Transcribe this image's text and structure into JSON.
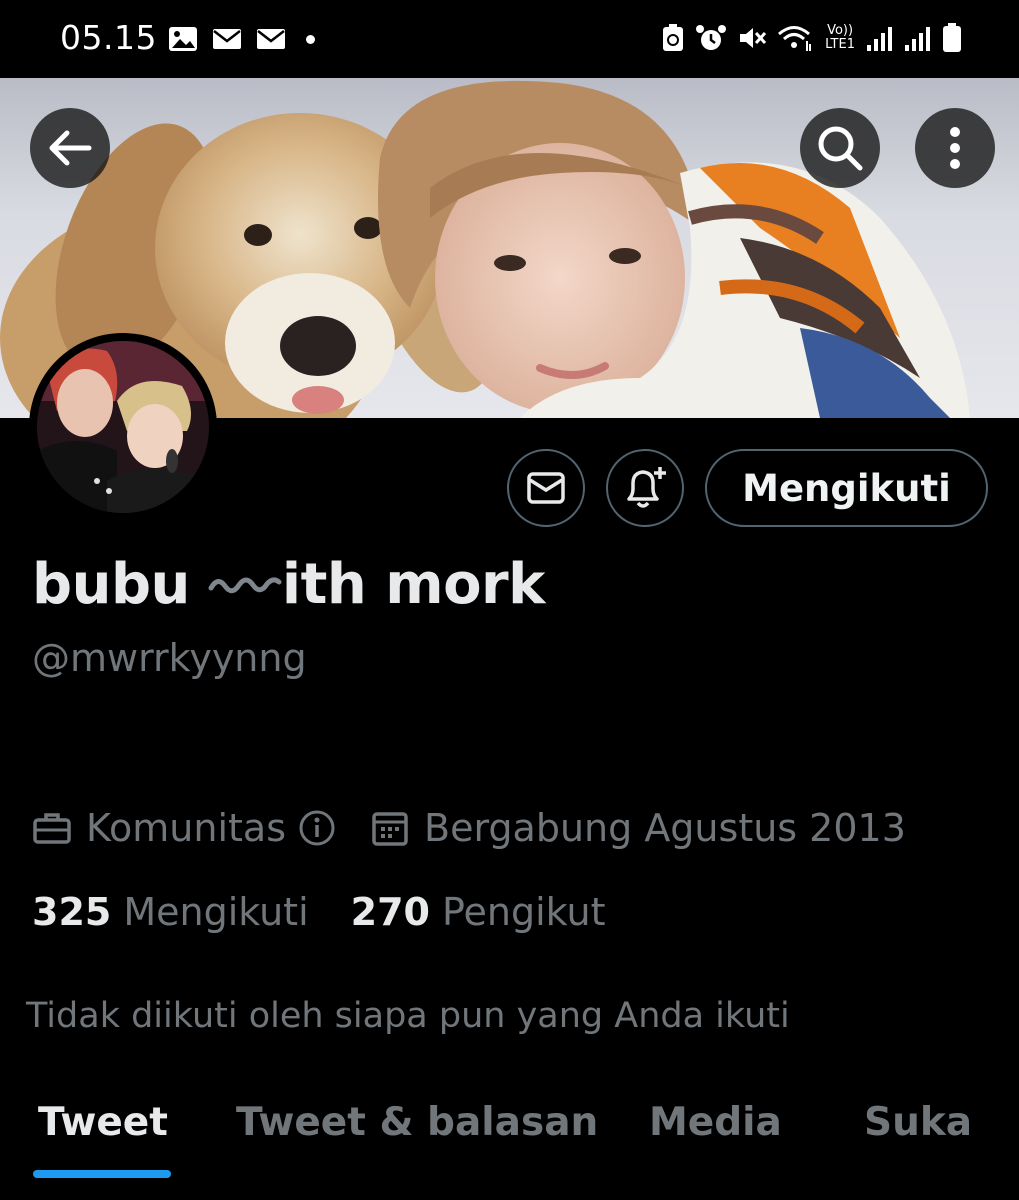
{
  "status_bar": {
    "time": "05.15",
    "lte_line1": "Vo))",
    "lte_line2": "LTE1"
  },
  "profile": {
    "display_name_prefix": "bubu",
    "display_name_suffix": "ith mork",
    "handle": "@mwrrkyynng",
    "category": "Komunitas",
    "joined": "Bergabung Agustus 2013",
    "following_count": "325",
    "following_label": "Mengikuti",
    "followers_count": "270",
    "followers_label": "Pengikut",
    "not_followed_text": "Tidak diikuti oleh siapa pun yang Anda ikuti"
  },
  "actions": {
    "follow_label": "Mengikuti"
  },
  "tabs": [
    {
      "label": "Tweet",
      "active": true
    },
    {
      "label": "Tweet & balasan",
      "active": false
    },
    {
      "label": "Media",
      "active": false
    },
    {
      "label": "Suka",
      "active": false
    }
  ],
  "colors": {
    "background": "#000000",
    "accent": "#1d9bf0",
    "secondary_text": "#71767b",
    "border": "#536471"
  }
}
